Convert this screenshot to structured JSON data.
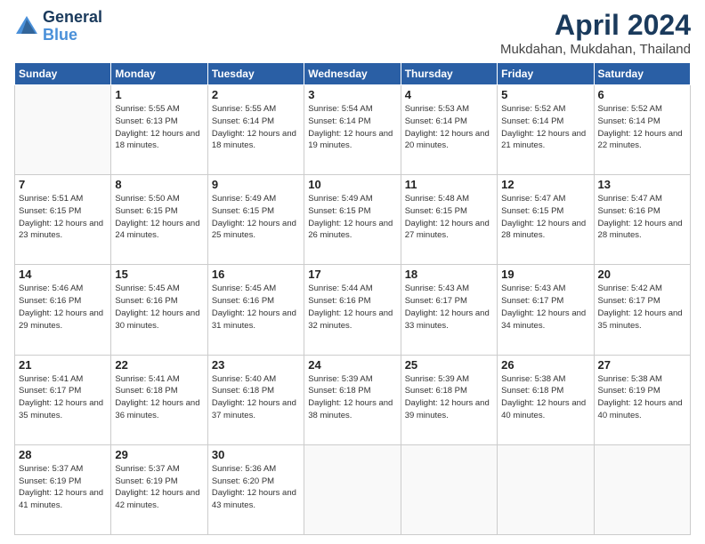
{
  "header": {
    "logo_line1": "General",
    "logo_line2": "Blue",
    "title": "April 2024",
    "subtitle": "Mukdahan, Mukdahan, Thailand"
  },
  "weekdays": [
    "Sunday",
    "Monday",
    "Tuesday",
    "Wednesday",
    "Thursday",
    "Friday",
    "Saturday"
  ],
  "days": [
    {
      "num": "",
      "info": ""
    },
    {
      "num": "1",
      "info": "Sunrise: 5:55 AM\nSunset: 6:13 PM\nDaylight: 12 hours\nand 18 minutes."
    },
    {
      "num": "2",
      "info": "Sunrise: 5:55 AM\nSunset: 6:14 PM\nDaylight: 12 hours\nand 18 minutes."
    },
    {
      "num": "3",
      "info": "Sunrise: 5:54 AM\nSunset: 6:14 PM\nDaylight: 12 hours\nand 19 minutes."
    },
    {
      "num": "4",
      "info": "Sunrise: 5:53 AM\nSunset: 6:14 PM\nDaylight: 12 hours\nand 20 minutes."
    },
    {
      "num": "5",
      "info": "Sunrise: 5:52 AM\nSunset: 6:14 PM\nDaylight: 12 hours\nand 21 minutes."
    },
    {
      "num": "6",
      "info": "Sunrise: 5:52 AM\nSunset: 6:14 PM\nDaylight: 12 hours\nand 22 minutes."
    },
    {
      "num": "7",
      "info": "Sunrise: 5:51 AM\nSunset: 6:15 PM\nDaylight: 12 hours\nand 23 minutes."
    },
    {
      "num": "8",
      "info": "Sunrise: 5:50 AM\nSunset: 6:15 PM\nDaylight: 12 hours\nand 24 minutes."
    },
    {
      "num": "9",
      "info": "Sunrise: 5:49 AM\nSunset: 6:15 PM\nDaylight: 12 hours\nand 25 minutes."
    },
    {
      "num": "10",
      "info": "Sunrise: 5:49 AM\nSunset: 6:15 PM\nDaylight: 12 hours\nand 26 minutes."
    },
    {
      "num": "11",
      "info": "Sunrise: 5:48 AM\nSunset: 6:15 PM\nDaylight: 12 hours\nand 27 minutes."
    },
    {
      "num": "12",
      "info": "Sunrise: 5:47 AM\nSunset: 6:15 PM\nDaylight: 12 hours\nand 28 minutes."
    },
    {
      "num": "13",
      "info": "Sunrise: 5:47 AM\nSunset: 6:16 PM\nDaylight: 12 hours\nand 28 minutes."
    },
    {
      "num": "14",
      "info": "Sunrise: 5:46 AM\nSunset: 6:16 PM\nDaylight: 12 hours\nand 29 minutes."
    },
    {
      "num": "15",
      "info": "Sunrise: 5:45 AM\nSunset: 6:16 PM\nDaylight: 12 hours\nand 30 minutes."
    },
    {
      "num": "16",
      "info": "Sunrise: 5:45 AM\nSunset: 6:16 PM\nDaylight: 12 hours\nand 31 minutes."
    },
    {
      "num": "17",
      "info": "Sunrise: 5:44 AM\nSunset: 6:16 PM\nDaylight: 12 hours\nand 32 minutes."
    },
    {
      "num": "18",
      "info": "Sunrise: 5:43 AM\nSunset: 6:17 PM\nDaylight: 12 hours\nand 33 minutes."
    },
    {
      "num": "19",
      "info": "Sunrise: 5:43 AM\nSunset: 6:17 PM\nDaylight: 12 hours\nand 34 minutes."
    },
    {
      "num": "20",
      "info": "Sunrise: 5:42 AM\nSunset: 6:17 PM\nDaylight: 12 hours\nand 35 minutes."
    },
    {
      "num": "21",
      "info": "Sunrise: 5:41 AM\nSunset: 6:17 PM\nDaylight: 12 hours\nand 35 minutes."
    },
    {
      "num": "22",
      "info": "Sunrise: 5:41 AM\nSunset: 6:18 PM\nDaylight: 12 hours\nand 36 minutes."
    },
    {
      "num": "23",
      "info": "Sunrise: 5:40 AM\nSunset: 6:18 PM\nDaylight: 12 hours\nand 37 minutes."
    },
    {
      "num": "24",
      "info": "Sunrise: 5:39 AM\nSunset: 6:18 PM\nDaylight: 12 hours\nand 38 minutes."
    },
    {
      "num": "25",
      "info": "Sunrise: 5:39 AM\nSunset: 6:18 PM\nDaylight: 12 hours\nand 39 minutes."
    },
    {
      "num": "26",
      "info": "Sunrise: 5:38 AM\nSunset: 6:18 PM\nDaylight: 12 hours\nand 40 minutes."
    },
    {
      "num": "27",
      "info": "Sunrise: 5:38 AM\nSunset: 6:19 PM\nDaylight: 12 hours\nand 40 minutes."
    },
    {
      "num": "28",
      "info": "Sunrise: 5:37 AM\nSunset: 6:19 PM\nDaylight: 12 hours\nand 41 minutes."
    },
    {
      "num": "29",
      "info": "Sunrise: 5:37 AM\nSunset: 6:19 PM\nDaylight: 12 hours\nand 42 minutes."
    },
    {
      "num": "30",
      "info": "Sunrise: 5:36 AM\nSunset: 6:20 PM\nDaylight: 12 hours\nand 43 minutes."
    },
    {
      "num": "",
      "info": ""
    },
    {
      "num": "",
      "info": ""
    },
    {
      "num": "",
      "info": ""
    },
    {
      "num": "",
      "info": ""
    }
  ]
}
